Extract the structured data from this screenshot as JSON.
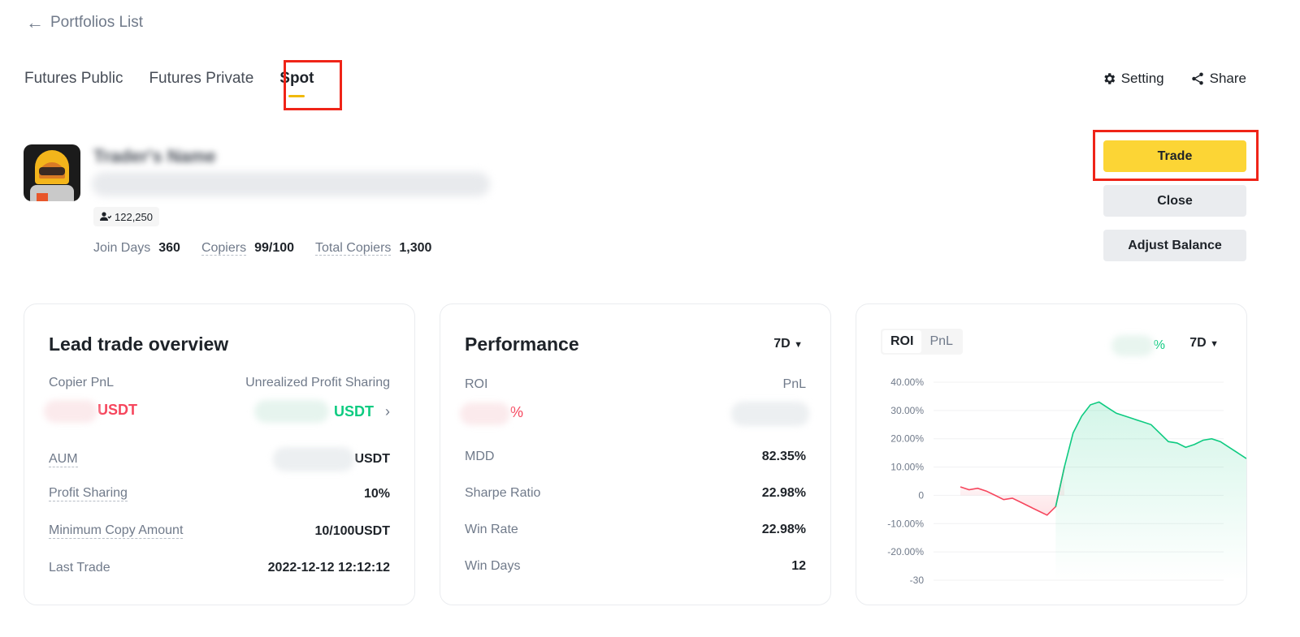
{
  "back": {
    "label": "Portfolios List"
  },
  "tabs": [
    {
      "label": "Futures Public"
    },
    {
      "label": "Futures Private"
    },
    {
      "label": "Spot"
    }
  ],
  "actions": {
    "setting": "Setting",
    "share": "Share"
  },
  "trader": {
    "name": "Trader's Name",
    "followers": "122,250",
    "stats": [
      {
        "label": "Join Days",
        "value": "360"
      },
      {
        "label": "Copiers",
        "value": "99/100"
      },
      {
        "label": "Total Copiers",
        "value": "1,300"
      }
    ]
  },
  "buttons": {
    "trade": "Trade",
    "close": "Close",
    "adjust": "Adjust Balance"
  },
  "overview": {
    "title": "Lead trade overview",
    "copier_pnl_label": "Copier PnL",
    "copier_pnl_unit": "USDT",
    "unrealized_label": "Unrealized Profit Sharing",
    "unrealized_unit": "USDT",
    "aum_label": "AUM",
    "aum_unit": "USDT",
    "profit_sharing_label": "Profit Sharing",
    "profit_sharing_value": "10%",
    "min_copy_label": "Minimum Copy Amount",
    "min_copy_value": "10/100USDT",
    "last_trade_label": "Last Trade",
    "last_trade_value": "2022-12-12 12:12:12"
  },
  "performance": {
    "title": "Performance",
    "period": "7D",
    "roi_label": "ROI",
    "roi_unit": "%",
    "pnl_label": "PnL",
    "mdd_label": "MDD",
    "mdd_value": "82.35%",
    "sharpe_label": "Sharpe Ratio",
    "sharpe_value": "22.98%",
    "winrate_label": "Win Rate",
    "winrate_value": "22.98%",
    "windays_label": "Win Days",
    "windays_value": "12"
  },
  "roi_chart": {
    "seg_roi": "ROI",
    "seg_pnl": "PnL",
    "percent_suffix": "%",
    "period": "7D"
  },
  "chart_data": {
    "type": "line",
    "y_ticks": [
      "40.00%",
      "30.00%",
      "20.00%",
      "10.00%",
      "0",
      "-10.00%",
      "-20.00%",
      "-30"
    ],
    "ylim": [
      -30,
      40
    ],
    "grid": true,
    "series": [
      {
        "values": [
          3,
          2,
          2.5,
          1.5,
          0,
          -1.5,
          -1,
          -2.5,
          -4,
          -5.5,
          -7,
          -4,
          10,
          22,
          28,
          32,
          33,
          31,
          29,
          28,
          27,
          26,
          25,
          22,
          19,
          18.5,
          17,
          18,
          19.5,
          20,
          19,
          17,
          15,
          13
        ]
      }
    ],
    "colors": {
      "positive": "#0ecb81",
      "negative": "#f6465d"
    }
  }
}
